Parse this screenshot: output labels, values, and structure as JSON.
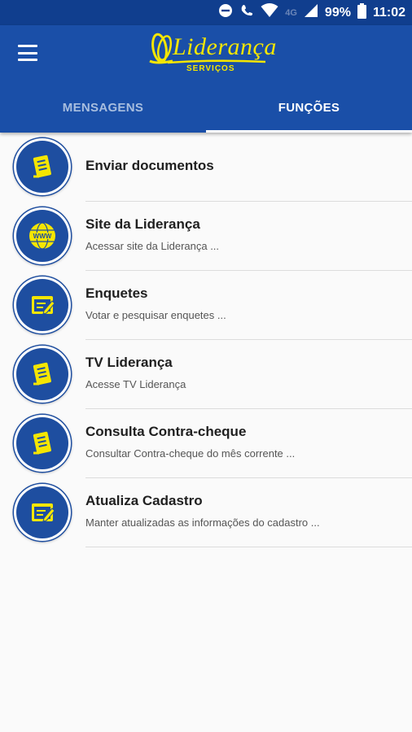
{
  "status_bar": {
    "battery": "99%",
    "time": "11:02",
    "network": "4G"
  },
  "app": {
    "logo_text": "Liderança",
    "logo_subtitle": "SERVIÇOS"
  },
  "tabs": [
    {
      "label": "MENSAGENS",
      "active": false
    },
    {
      "label": "FUNÇÕES",
      "active": true
    }
  ],
  "functions": [
    {
      "title": "Enviar documentos",
      "subtitle": "",
      "icon": "document-icon"
    },
    {
      "title": "Site da Liderança",
      "subtitle": "Acessar site da Liderança ...",
      "icon": "globe-www-icon"
    },
    {
      "title": "Enquetes",
      "subtitle": "Votar e pesquisar enquetes ...",
      "icon": "edit-form-icon"
    },
    {
      "title": "TV Liderança",
      "subtitle": "Acesse TV Liderança",
      "icon": "document-icon"
    },
    {
      "title": "Consulta Contra-cheque",
      "subtitle": "Consultar Contra-cheque do mês corrente ...",
      "icon": "document-icon"
    },
    {
      "title": "Atualiza Cadastro",
      "subtitle": "Manter atualizadas as informações do cadastro ...",
      "icon": "edit-form-icon"
    }
  ],
  "colors": {
    "primary": "#1a4fa8",
    "status_bar": "#103e8e",
    "accent": "#f5e600"
  }
}
